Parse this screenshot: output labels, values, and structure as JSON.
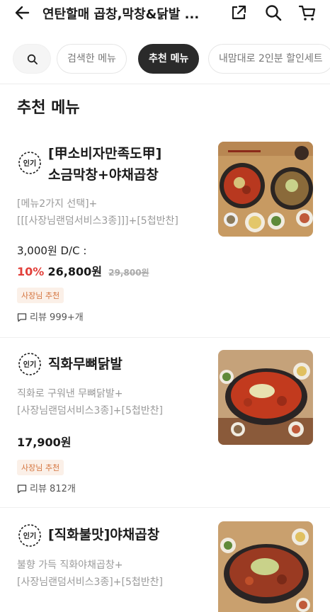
{
  "header": {
    "title": "연탄할매 곱창,막창&닭발 ..."
  },
  "chips": {
    "items": [
      {
        "label": "검색한 메뉴"
      },
      {
        "label": "추천 메뉴"
      },
      {
        "label": "내맘대로 2인분 할인세트"
      }
    ]
  },
  "section": {
    "title": "추천 메뉴"
  },
  "popular_label": "인기",
  "items": [
    {
      "name_line1": "[甲소비자만족도甲]",
      "name_line2": "소금막창+야채곱창",
      "desc_line1": "[메뉴2가지 선택]+",
      "desc_line2": "[[[사장님랜덤서비스3종]]]+[5첩반찬]",
      "price_note": "3,000원 D/C :",
      "discount": "10%",
      "price": "26,800원",
      "original_price": "29,800원",
      "tag": "사장님 추천",
      "review": "리뷰 999+개"
    },
    {
      "name_line1": "직화무뼈닭발",
      "desc_line1": "직화로 구워낸 무뼈닭발+",
      "desc_line2": "[사장님랜덤서비스3종]+[5첩반찬]",
      "price": "17,900원",
      "tag": "사장님 추천",
      "review": "리뷰 812개"
    },
    {
      "name_line1": "[직화불맛]야채곱창",
      "desc_line1": "불향 가득 직화야채곱창+",
      "desc_line2": "[사장님랜덤서비스3종]+[5첩반찬]"
    }
  ]
}
